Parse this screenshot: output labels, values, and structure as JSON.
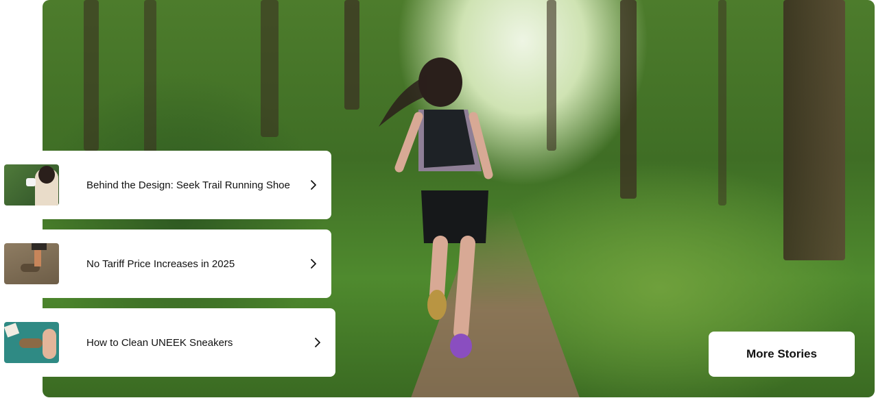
{
  "hero": {
    "image_label": "trail-runner-forest"
  },
  "stories": [
    {
      "title": "Behind the Design: Seek Trail Running Shoe",
      "thumb": "designer-megaphone"
    },
    {
      "title": "No Tariff Price Increases in 2025",
      "thumb": "hiking-feet"
    },
    {
      "title": "How to Clean UNEEK Sneakers",
      "thumb": "shoe-cleaning"
    }
  ],
  "more_button": {
    "label": "More Stories"
  },
  "colors": {
    "card": "#ffffff",
    "text": "#111111",
    "forest": "#4d7c2c"
  }
}
